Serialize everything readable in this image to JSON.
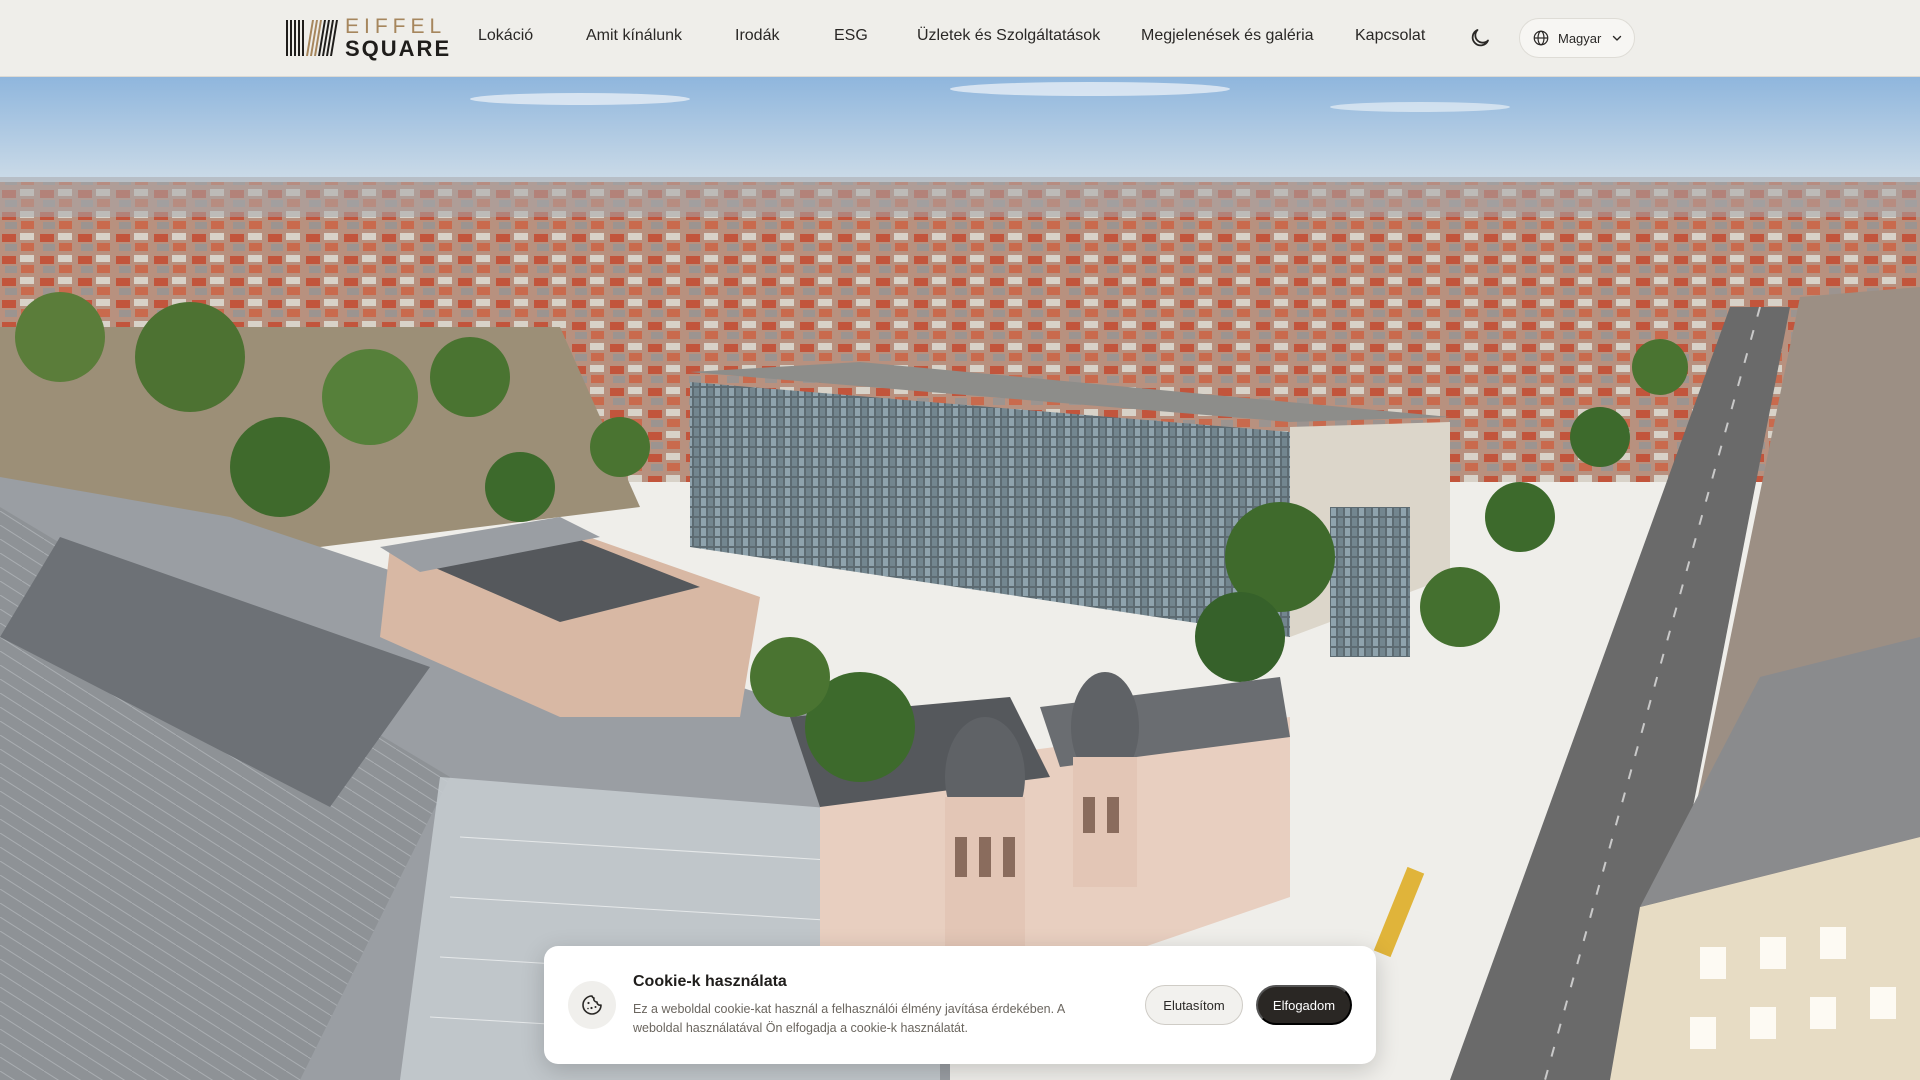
{
  "brand": {
    "name_top": "EIFFEL",
    "name_bottom": "SQUARE",
    "accent_color": "#a6865d"
  },
  "nav": {
    "items": [
      {
        "label": "Lokáció"
      },
      {
        "label": "Amit kínálunk"
      },
      {
        "label": "Irodák"
      },
      {
        "label": "ESG"
      },
      {
        "label": "Üzletek és Szolgáltatások"
      },
      {
        "label": "Megjelenések és galéria"
      },
      {
        "label": "Kapcsolat"
      }
    ],
    "theme_toggle_icon": "moon-icon",
    "language": {
      "icon": "globe-icon",
      "selected": "Magyar",
      "chevron_icon": "chevron-down-icon"
    }
  },
  "hero": {
    "image": "aerial-city-view"
  },
  "cookie_banner": {
    "icon": "cookie-icon",
    "title": "Cookie-k használata",
    "text": "Ez a weboldal cookie-kat használ a felhasználói élmény javítása érdekében. A weboldal használatával Ön elfogadja a cookie-k használatát.",
    "decline_label": "Elutasítom",
    "accept_label": "Elfogadom",
    "accept_color": "#2a2724"
  }
}
